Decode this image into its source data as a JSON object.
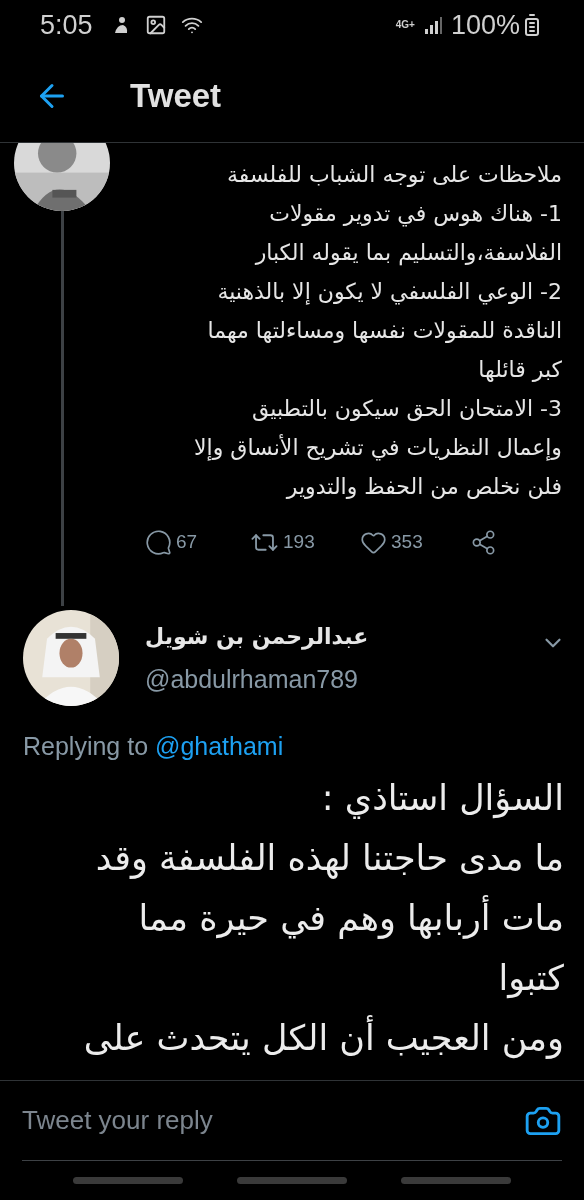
{
  "status_bar": {
    "time": "5:05",
    "network": "4G+",
    "battery": "100%"
  },
  "header": {
    "title": "Tweet"
  },
  "parent_tweet": {
    "text": "ملاحظات على توجه الشباب للفلسفة\n1- هناك هوس في تدوير مقولات\nالفلاسفة،والتسليم بما يقوله الكبار\n2- الوعي الفلسفي لا يكون إلا بالذهنية\nالناقدة للمقولات نفسها ومساءلتها مهما\nكبر قائلها\n3- الامتحان الحق سيكون بالتطبيق\nوإعمال النظريات في تشريح الأنساق وإلا\nفلن نخلص من الحفظ والتدوير",
    "replies": "67",
    "retweets": "193",
    "likes": "353"
  },
  "reply_tweet": {
    "name": "عبدالرحمن بن شويل",
    "handle": "@abdulrhaman789",
    "replying_label": "Replying to",
    "replying_to": "@ghathami",
    "text": "السؤال استاذي :\nما مدى حاجتنا لهذه الفلسفة وقد\nمات أربابها وهم في حيرة مما\nكتبوا\nومن العجيب أن الكل يتحدث على"
  },
  "compose": {
    "placeholder": "Tweet your reply"
  }
}
